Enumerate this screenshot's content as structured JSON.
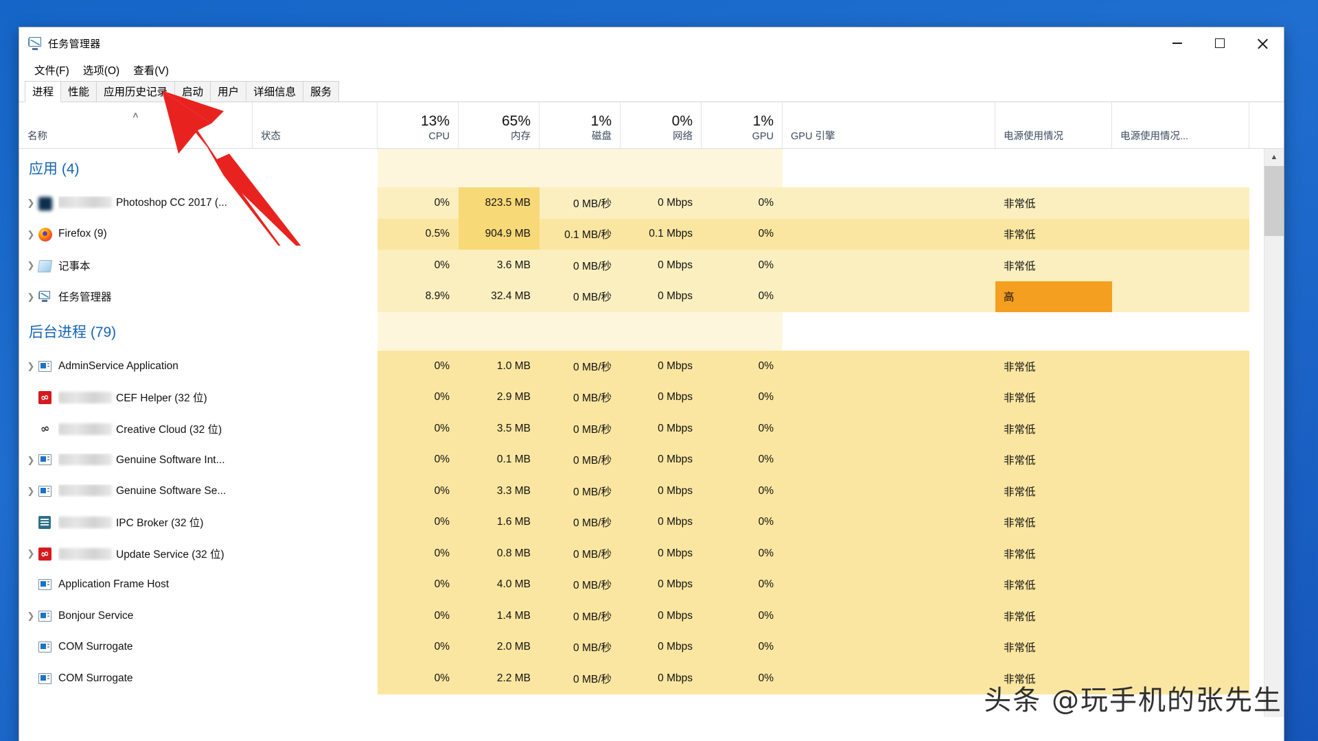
{
  "window": {
    "title": "任务管理器",
    "app_icon": "task-manager-icon",
    "controls": {
      "minimize": "minimize-icon",
      "maximize": "maximize-icon",
      "close": "close-icon"
    }
  },
  "menubar": {
    "items": [
      "文件(F)",
      "选项(O)",
      "查看(V)"
    ]
  },
  "tabs": {
    "active_index": 0,
    "items": [
      "进程",
      "性能",
      "应用历史记录",
      "启动",
      "用户",
      "详细信息",
      "服务"
    ]
  },
  "columns": [
    {
      "key": "name",
      "label": "名称",
      "value": "",
      "align": "left",
      "sorted": true,
      "sort_caret": "˄"
    },
    {
      "key": "status",
      "label": "状态",
      "value": "",
      "align": "left"
    },
    {
      "key": "cpu",
      "label": "CPU",
      "value": "13%",
      "align": "right"
    },
    {
      "key": "mem",
      "label": "内存",
      "value": "65%",
      "align": "right"
    },
    {
      "key": "disk",
      "label": "磁盘",
      "value": "1%",
      "align": "right"
    },
    {
      "key": "net",
      "label": "网络",
      "value": "0%",
      "align": "right"
    },
    {
      "key": "gpu",
      "label": "GPU",
      "value": "1%",
      "align": "right"
    },
    {
      "key": "gpueng",
      "label": "GPU 引擎",
      "value": "",
      "align": "left"
    },
    {
      "key": "pwr",
      "label": "电源使用情况",
      "value": "",
      "align": "left"
    },
    {
      "key": "pwrt",
      "label": "电源使用情况...",
      "value": "",
      "align": "left"
    }
  ],
  "groups": [
    {
      "title": "应用 (4)",
      "rows": [
        {
          "icon": "photoshop-icon",
          "blurred_prefix": true,
          "expandable": true,
          "name": "Photoshop CC 2017 (...",
          "status": "",
          "cpu": "0%",
          "mem": "823.5 MB",
          "disk": "0 MB/秒",
          "net": "0 Mbps",
          "gpu": "0%",
          "gpueng": "",
          "power": "非常低",
          "power_trend": "",
          "heat": {
            "row": 2,
            "cpu": 2,
            "mem": 4,
            "disk": 2,
            "net": 2,
            "gpu": 2,
            "gpueng": 2,
            "power": 2,
            "power_trend": 2
          }
        },
        {
          "icon": "firefox-icon",
          "blurred_prefix": false,
          "expandable": true,
          "name": "Firefox (9)",
          "status": "",
          "cpu": "0.5%",
          "mem": "904.9 MB",
          "disk": "0.1 MB/秒",
          "net": "0.1 Mbps",
          "gpu": "0%",
          "gpueng": "",
          "power": "非常低",
          "power_trend": "",
          "heat": {
            "row": 3,
            "cpu": 3,
            "mem": 4,
            "disk": 3,
            "net": 3,
            "gpu": 3,
            "gpueng": 3,
            "power": 3,
            "power_trend": 3
          }
        },
        {
          "icon": "notepad-icon",
          "blurred_prefix": false,
          "expandable": true,
          "name": "记事本",
          "status": "",
          "cpu": "0%",
          "mem": "3.6 MB",
          "disk": "0 MB/秒",
          "net": "0 Mbps",
          "gpu": "0%",
          "gpueng": "",
          "power": "非常低",
          "power_trend": "",
          "heat": {
            "row": 2,
            "cpu": 2,
            "mem": 2,
            "disk": 2,
            "net": 2,
            "gpu": 2,
            "gpueng": 2,
            "power": 2,
            "power_trend": 2
          }
        },
        {
          "icon": "task-manager-icon",
          "blurred_prefix": false,
          "expandable": true,
          "name": "任务管理器",
          "status": "",
          "cpu": "8.9%",
          "mem": "32.4 MB",
          "disk": "0 MB/秒",
          "net": "0 Mbps",
          "gpu": "0%",
          "gpueng": "",
          "power": "高",
          "power_trend": "",
          "heat": {
            "row": 2,
            "cpu": 2,
            "mem": 2,
            "disk": 2,
            "net": 2,
            "gpu": 2,
            "gpueng": 2,
            "power": 5,
            "power_trend": 2
          }
        }
      ]
    },
    {
      "title": "后台进程 (79)",
      "rows": [
        {
          "icon": "window-icon",
          "blurred_prefix": false,
          "expandable": true,
          "name": "AdminService Application",
          "status": "",
          "cpu": "0%",
          "mem": "1.0 MB",
          "disk": "0 MB/秒",
          "net": "0 Mbps",
          "gpu": "0%",
          "gpueng": "",
          "power": "非常低",
          "power_trend": "",
          "heat": {
            "row": 3,
            "cpu": 3,
            "mem": 3,
            "disk": 3,
            "net": 3,
            "gpu": 3,
            "gpueng": 3,
            "power": 3,
            "power_trend": 3
          }
        },
        {
          "icon": "creative-cloud-red-icon",
          "blurred_prefix": true,
          "expandable": false,
          "name": "CEF Helper (32 位)",
          "status": "",
          "cpu": "0%",
          "mem": "2.9 MB",
          "disk": "0 MB/秒",
          "net": "0 Mbps",
          "gpu": "0%",
          "gpueng": "",
          "power": "非常低",
          "power_trend": "",
          "heat": {
            "row": 3,
            "cpu": 3,
            "mem": 3,
            "disk": 3,
            "net": 3,
            "gpu": 3,
            "gpueng": 3,
            "power": 3,
            "power_trend": 3
          }
        },
        {
          "icon": "creative-cloud-gray-icon",
          "blurred_prefix": true,
          "expandable": false,
          "name": "Creative Cloud (32 位)",
          "status": "",
          "cpu": "0%",
          "mem": "3.5 MB",
          "disk": "0 MB/秒",
          "net": "0 Mbps",
          "gpu": "0%",
          "gpueng": "",
          "power": "非常低",
          "power_trend": "",
          "heat": {
            "row": 3,
            "cpu": 3,
            "mem": 3,
            "disk": 3,
            "net": 3,
            "gpu": 3,
            "gpueng": 3,
            "power": 3,
            "power_trend": 3
          }
        },
        {
          "icon": "window-icon",
          "blurred_prefix": true,
          "expandable": true,
          "name": "Genuine Software Int...",
          "status": "",
          "cpu": "0%",
          "mem": "0.1 MB",
          "disk": "0 MB/秒",
          "net": "0 Mbps",
          "gpu": "0%",
          "gpueng": "",
          "power": "非常低",
          "power_trend": "",
          "heat": {
            "row": 3,
            "cpu": 3,
            "mem": 3,
            "disk": 3,
            "net": 3,
            "gpu": 3,
            "gpueng": 3,
            "power": 3,
            "power_trend": 3
          }
        },
        {
          "icon": "window-icon",
          "blurred_prefix": true,
          "expandable": true,
          "name": "Genuine Software Se...",
          "status": "",
          "cpu": "0%",
          "mem": "3.3 MB",
          "disk": "0 MB/秒",
          "net": "0 Mbps",
          "gpu": "0%",
          "gpueng": "",
          "power": "非常低",
          "power_trend": "",
          "heat": {
            "row": 3,
            "cpu": 3,
            "mem": 3,
            "disk": 3,
            "net": 3,
            "gpu": 3,
            "gpueng": 3,
            "power": 3,
            "power_trend": 3
          }
        },
        {
          "icon": "ipc-broker-icon",
          "blurred_prefix": true,
          "expandable": false,
          "name": "IPC Broker (32 位)",
          "status": "",
          "cpu": "0%",
          "mem": "1.6 MB",
          "disk": "0 MB/秒",
          "net": "0 Mbps",
          "gpu": "0%",
          "gpueng": "",
          "power": "非常低",
          "power_trend": "",
          "heat": {
            "row": 3,
            "cpu": 3,
            "mem": 3,
            "disk": 3,
            "net": 3,
            "gpu": 3,
            "gpueng": 3,
            "power": 3,
            "power_trend": 3
          }
        },
        {
          "icon": "creative-cloud-red-icon",
          "blurred_prefix": true,
          "expandable": true,
          "name": "Update Service (32 位)",
          "status": "",
          "cpu": "0%",
          "mem": "0.8 MB",
          "disk": "0 MB/秒",
          "net": "0 Mbps",
          "gpu": "0%",
          "gpueng": "",
          "power": "非常低",
          "power_trend": "",
          "heat": {
            "row": 3,
            "cpu": 3,
            "mem": 3,
            "disk": 3,
            "net": 3,
            "gpu": 3,
            "gpueng": 3,
            "power": 3,
            "power_trend": 3
          }
        },
        {
          "icon": "window-icon",
          "blurred_prefix": false,
          "expandable": false,
          "name": "Application Frame Host",
          "status": "",
          "cpu": "0%",
          "mem": "4.0 MB",
          "disk": "0 MB/秒",
          "net": "0 Mbps",
          "gpu": "0%",
          "gpueng": "",
          "power": "非常低",
          "power_trend": "",
          "heat": {
            "row": 3,
            "cpu": 3,
            "mem": 3,
            "disk": 3,
            "net": 3,
            "gpu": 3,
            "gpueng": 3,
            "power": 3,
            "power_trend": 3
          }
        },
        {
          "icon": "window-icon",
          "blurred_prefix": false,
          "expandable": true,
          "name": "Bonjour Service",
          "status": "",
          "cpu": "0%",
          "mem": "1.4 MB",
          "disk": "0 MB/秒",
          "net": "0 Mbps",
          "gpu": "0%",
          "gpueng": "",
          "power": "非常低",
          "power_trend": "",
          "heat": {
            "row": 3,
            "cpu": 3,
            "mem": 3,
            "disk": 3,
            "net": 3,
            "gpu": 3,
            "gpueng": 3,
            "power": 3,
            "power_trend": 3
          }
        },
        {
          "icon": "window-icon",
          "blurred_prefix": false,
          "expandable": false,
          "name": "COM Surrogate",
          "status": "",
          "cpu": "0%",
          "mem": "2.0 MB",
          "disk": "0 MB/秒",
          "net": "0 Mbps",
          "gpu": "0%",
          "gpueng": "",
          "power": "非常低",
          "power_trend": "",
          "heat": {
            "row": 3,
            "cpu": 3,
            "mem": 3,
            "disk": 3,
            "net": 3,
            "gpu": 3,
            "gpueng": 3,
            "power": 3,
            "power_trend": 3
          }
        },
        {
          "icon": "window-icon",
          "blurred_prefix": false,
          "expandable": false,
          "name": "COM Surrogate",
          "status": "",
          "cpu": "0%",
          "mem": "2.2 MB",
          "disk": "0 MB/秒",
          "net": "0 Mbps",
          "gpu": "0%",
          "gpueng": "",
          "power": "非常低",
          "power_trend": "",
          "heat": {
            "row": 3,
            "cpu": 3,
            "mem": 3,
            "disk": 3,
            "net": 3,
            "gpu": 3,
            "gpueng": 3,
            "power": 3,
            "power_trend": 3
          }
        }
      ]
    }
  ],
  "scrollbar": {
    "up_arrow": "chevron-up-icon"
  },
  "annotation": {
    "type": "red-arrow",
    "points_at": "启动",
    "color": "#e8231f"
  },
  "watermark": {
    "text": "头条 @玩手机的张先生"
  }
}
